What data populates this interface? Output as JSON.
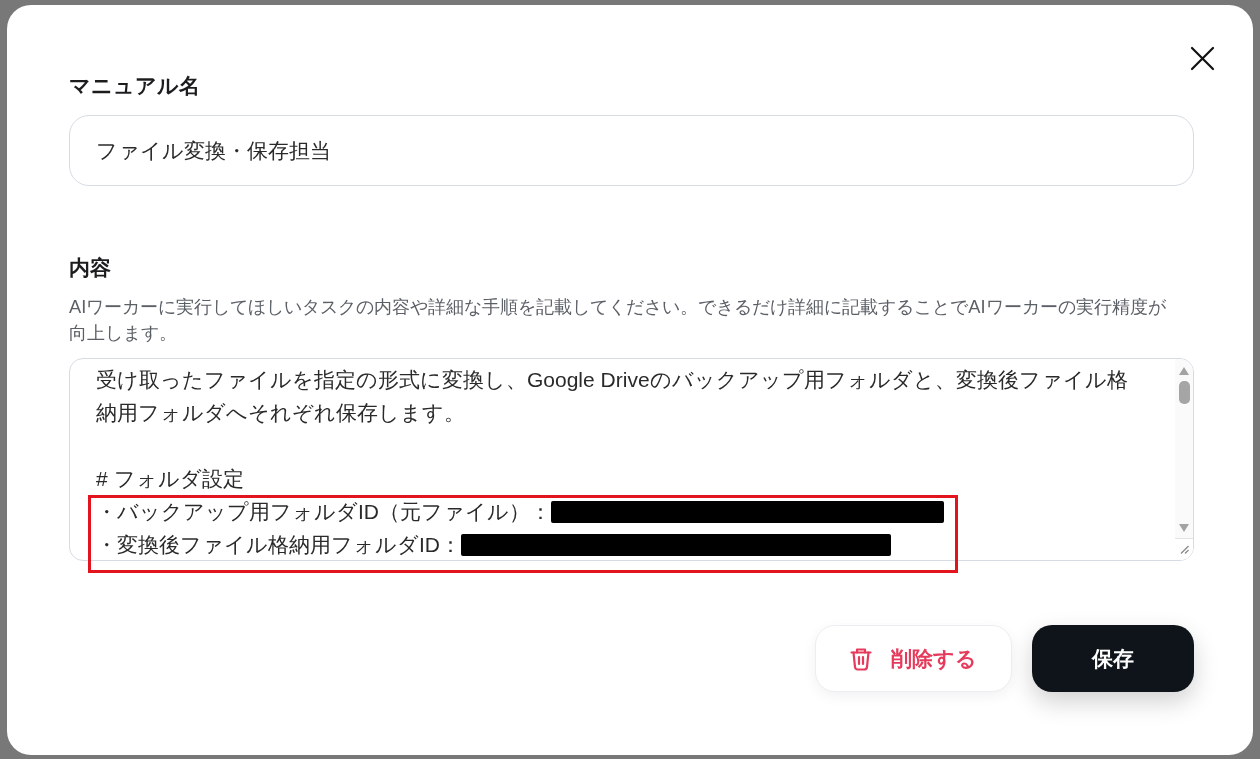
{
  "name_field": {
    "label": "マニュアル名",
    "value": "ファイル変換・保存担当"
  },
  "content_field": {
    "label": "内容",
    "help": "AIワーカーに実行してほしいタスクの内容や詳細な手順を記載してください。できるだけ詳細に記載することでAIワーカーの実行精度が向上します。",
    "paragraphs": [
      {
        "lines": [
          {
            "text": "受け取ったファイルを指定の形式に変換し、Google Driveのバックアップ用フォルダと、変換後ファイル格納用フォルダへそれぞれ保存します。",
            "redacted": false,
            "highlighted": false
          }
        ]
      },
      {
        "lines": [
          {
            "text": "# フォルダ設定",
            "redacted": false,
            "highlighted": false
          },
          {
            "text": "・バックアップ用フォルダID（元ファイル）：",
            "redacted": true,
            "highlighted": true
          },
          {
            "text": "・変換後ファイル格納用フォルダID：",
            "redacted": true,
            "highlighted": true
          }
        ]
      }
    ]
  },
  "actions": [
    {
      "kind": "delete",
      "label": "削除する"
    },
    {
      "kind": "save",
      "label": "保存"
    }
  ]
}
